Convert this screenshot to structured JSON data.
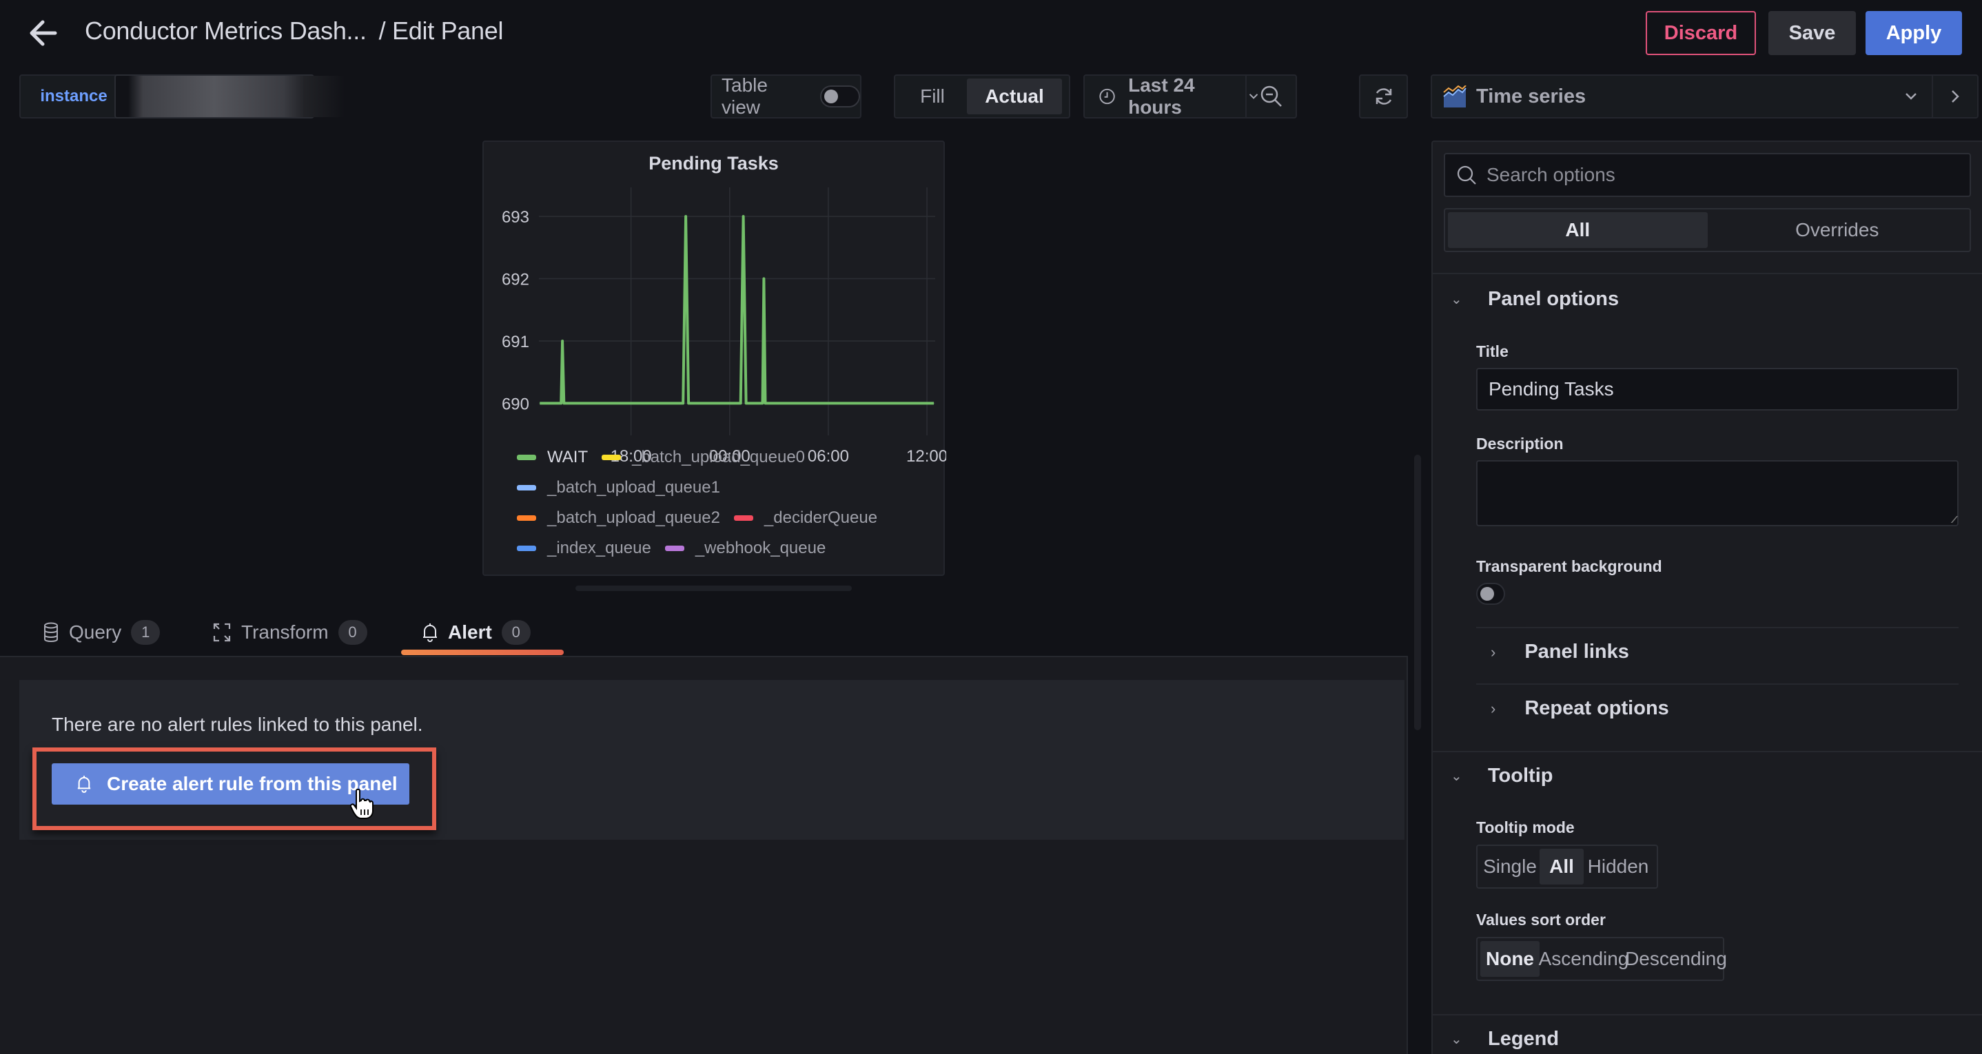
{
  "header": {
    "dashboard_title": "Conductor Metrics Dash...",
    "page_suffix": "/ Edit Panel",
    "discard_label": "Discard",
    "save_label": "Save",
    "apply_label": "Apply"
  },
  "toolbar": {
    "variable_label": "instance",
    "variable_value": "",
    "table_view_label": "Table view",
    "table_view_on": false,
    "fill_label": "Fill",
    "actual_label": "Actual",
    "active_size_mode": "Actual",
    "time_range_label": "Last 24 hours",
    "visualization_label": "Time series"
  },
  "panel": {
    "title": "Pending Tasks"
  },
  "chart_data": {
    "type": "line",
    "title": "Pending Tasks",
    "xlabel": "",
    "ylabel": "",
    "x_tick_labels": [
      "18:00",
      "00:00",
      "06:00",
      "12:00"
    ],
    "y_tick_labels": [
      "690",
      "691",
      "692",
      "693"
    ],
    "ylim": [
      689.75,
      693.2
    ],
    "xlim_hours": [
      12.4,
      36.5
    ],
    "grid": true,
    "legend_position": "bottom",
    "series": [
      {
        "name": "WAIT",
        "color": "#73bf69",
        "points": [
          {
            "t": "12:27",
            "h": 12.45,
            "v": 690
          },
          {
            "t": "13:45",
            "h": 13.75,
            "v": 690
          },
          {
            "t": "13:50",
            "h": 13.83,
            "v": 691
          },
          {
            "t": "13:55",
            "h": 13.92,
            "v": 690
          },
          {
            "t": "21:10",
            "h": 21.17,
            "v": 690
          },
          {
            "t": "21:20",
            "h": 21.33,
            "v": 693
          },
          {
            "t": "21:30",
            "h": 21.5,
            "v": 690
          },
          {
            "t": "00:40",
            "h": 24.67,
            "v": 690
          },
          {
            "t": "00:50",
            "h": 24.83,
            "v": 693
          },
          {
            "t": "01:00",
            "h": 25.0,
            "v": 690
          },
          {
            "t": "02:00",
            "h": 26.0,
            "v": 690
          },
          {
            "t": "02:05",
            "h": 26.08,
            "v": 692
          },
          {
            "t": "02:10",
            "h": 26.17,
            "v": 690
          },
          {
            "t": "12:25",
            "h": 36.42,
            "v": 690
          }
        ]
      },
      {
        "name": "_batch_upload_queue0",
        "color": "#fade2a",
        "points": []
      },
      {
        "name": "_batch_upload_queue1",
        "color": "#8ab8ff",
        "points": []
      },
      {
        "name": "_batch_upload_queue2",
        "color": "#ff7f2a",
        "points": []
      },
      {
        "name": "_deciderQueue",
        "color": "#f2495c",
        "points": []
      },
      {
        "name": "_index_queue",
        "color": "#5794f2",
        "points": []
      },
      {
        "name": "_webhook_queue",
        "color": "#b877d9",
        "points": []
      }
    ]
  },
  "legend_rows": [
    [
      0,
      1
    ],
    [
      2
    ],
    [
      3,
      4
    ],
    [
      5,
      6
    ]
  ],
  "tabs": [
    {
      "label": "Query",
      "count": "1",
      "active": false
    },
    {
      "label": "Transform",
      "count": "0",
      "active": false
    },
    {
      "label": "Alert",
      "count": "0",
      "active": true
    }
  ],
  "alert": {
    "empty_message": "There are no alert rules linked to this panel.",
    "create_button_label": "Create alert rule from this panel"
  },
  "options": {
    "search_placeholder": "Search options",
    "tab_all": "All",
    "tab_overrides": "Overrides",
    "active_tab": "All",
    "panel_options_header": "Panel options",
    "title_label": "Title",
    "title_value": "Pending Tasks",
    "description_label": "Description",
    "description_value": "",
    "transparent_label": "Transparent background",
    "transparent_on": false,
    "panel_links_label": "Panel links",
    "repeat_options_label": "Repeat options",
    "tooltip_header": "Tooltip",
    "tooltip_mode_label": "Tooltip mode",
    "tooltip_modes": [
      "Single",
      "All",
      "Hidden"
    ],
    "tooltip_mode_selected": "All",
    "sort_order_label": "Values sort order",
    "sort_orders": [
      "None",
      "Ascending",
      "Descending"
    ],
    "sort_order_selected": "None",
    "legend_header": "Legend"
  },
  "colors": {
    "accent_primary": "#4a72d6",
    "destructive": "#ef5b85",
    "active_tab_underline": "#f0894a",
    "highlight_box": "#e6614f"
  }
}
